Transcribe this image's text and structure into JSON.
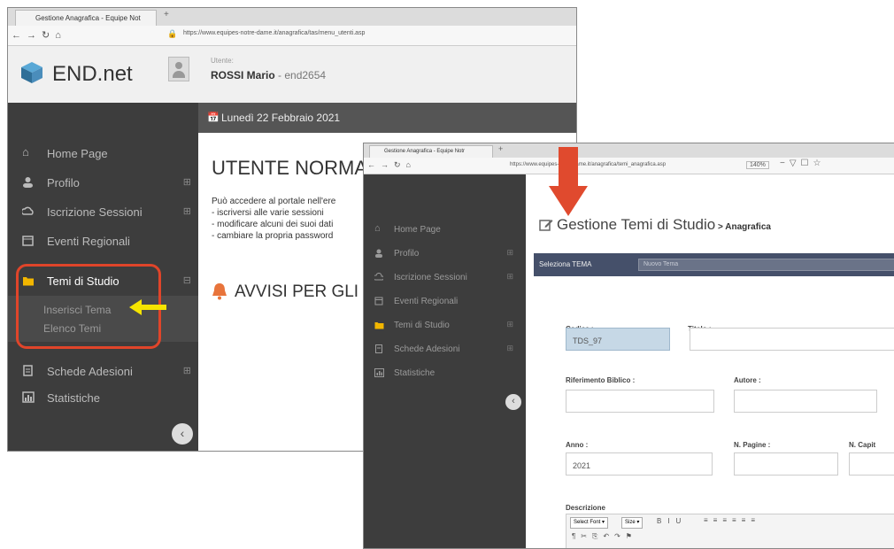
{
  "window1": {
    "tab_title": "Gestione Anagrafica - Equipe Not",
    "url": "https://www.equipes-notre-dame.it/anagrafica/tas/menu_utenti.asp",
    "brand": "END.net",
    "user_caption": "Utente:",
    "user_name": "ROSSI Mario",
    "user_code": " - end2654",
    "date": "Lunedì 22 Febbraio 2021",
    "sidebar": [
      {
        "label": "Home Page",
        "icon": "home-icon",
        "expandable": false
      },
      {
        "label": "Profilo",
        "icon": "user-icon",
        "expandable": true
      },
      {
        "label": "Iscrizione Sessioni",
        "icon": "cloud-icon",
        "expandable": true
      },
      {
        "label": "Eventi Regionali",
        "icon": "calendar-icon",
        "expandable": false
      },
      {
        "label": "Temi di Studio",
        "icon": "folder-icon",
        "expandable": true
      },
      {
        "label": "Schede Adesioni",
        "icon": "document-icon",
        "expandable": true
      },
      {
        "label": "Statistiche",
        "icon": "chart-icon",
        "expandable": false
      }
    ],
    "submenu": [
      "Inserisci Tema",
      "Elenco Temi"
    ],
    "heading": "UTENTE NORMALE",
    "body_lines": [
      "Può accedere al portale nell'ere",
      "- iscriversi alle varie sessioni",
      "- modificare alcuni dei suoi dati",
      "- cambiare la propria password"
    ],
    "notice": "AVVISI PER GLI"
  },
  "window2": {
    "tab_title": "Gestione Anagrafica - Equipe Notr",
    "url": "https://www.equipes-notre-dame.it/anagrafica/temi_anagrafica.asp",
    "zoom": "140%",
    "sidebar": [
      {
        "label": "Home Page",
        "icon": "home-icon",
        "expandable": false
      },
      {
        "label": "Profilo",
        "icon": "user-icon",
        "expandable": true
      },
      {
        "label": "Iscrizione Sessioni",
        "icon": "cloud-icon",
        "expandable": true
      },
      {
        "label": "Eventi Regionali",
        "icon": "calendar-icon",
        "expandable": false
      },
      {
        "label": "Temi di Studio",
        "icon": "folder-icon",
        "expandable": true
      },
      {
        "label": "Schede Adesioni",
        "icon": "document-icon",
        "expandable": true
      },
      {
        "label": "Statistiche",
        "icon": "chart-icon",
        "expandable": false
      }
    ],
    "page_title": "Gestione Temi di Studio",
    "page_subtitle": " > Anagrafica",
    "select_label": "Seleziona TEMA",
    "select_value": "Nuovo Tema",
    "fields": {
      "codice_label": "Codice :",
      "codice_value": "TDS_97",
      "titolo_label": "Titolo :",
      "riferimento_label": "Riferimento Biblico :",
      "autore_label": "Autore :",
      "anno_label": "Anno :",
      "anno_value": "2021",
      "pagine_label": "N. Pagine :",
      "capitoli_label": "N. Capit",
      "descrizione_label": "Descrizione"
    },
    "editor": {
      "font_select": "Select Font",
      "size_select": "Size"
    }
  },
  "colors": {
    "sidebar_bg": "#3d3d3d",
    "highlight_border": "#e0452a",
    "arrow_red": "#e04a2e",
    "arrow_yellow": "#f5e400",
    "folder_icon": "#f2b600",
    "bell_icon": "#e8743b",
    "select_bar": "#45506a"
  }
}
